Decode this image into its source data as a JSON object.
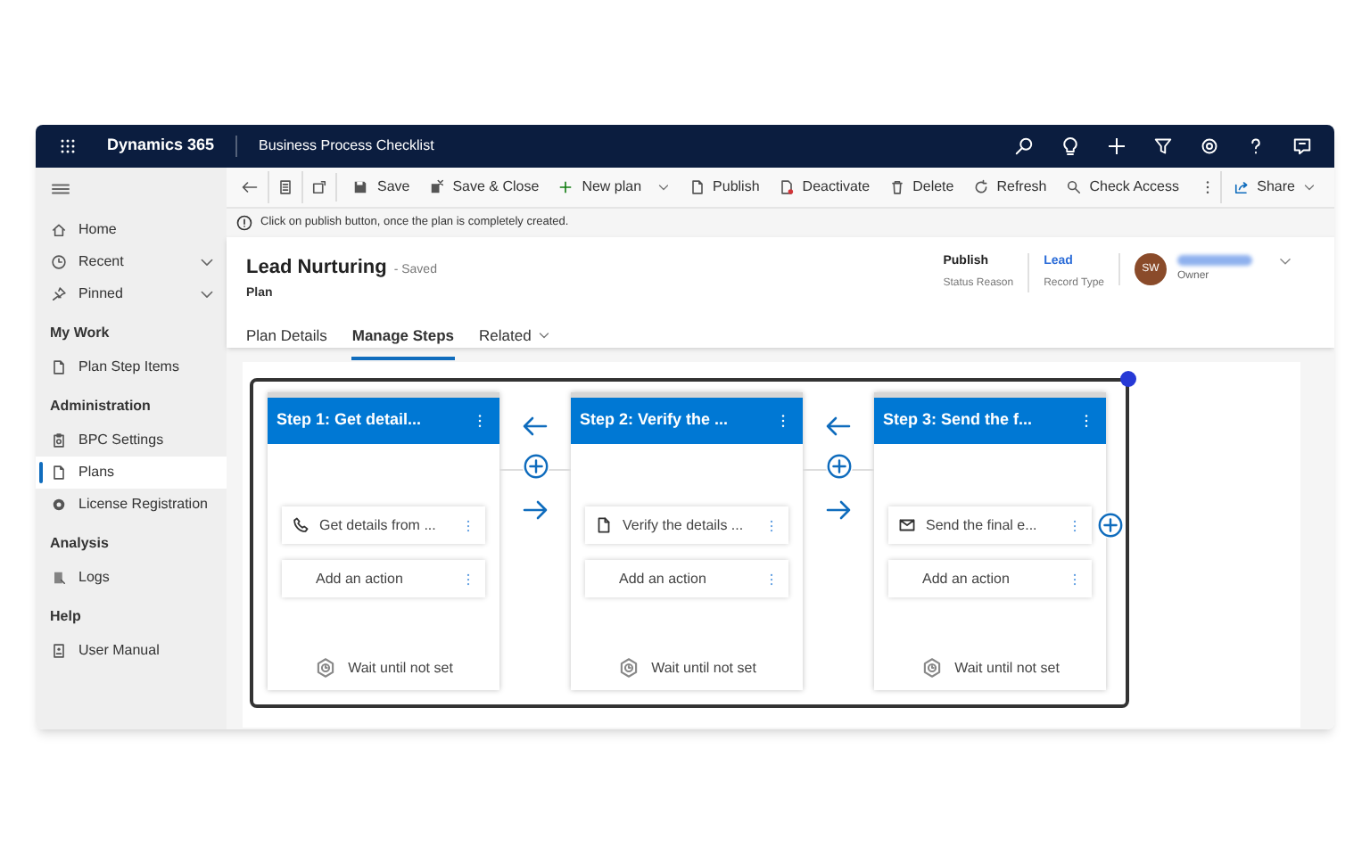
{
  "app": {
    "brand": "Dynamics 365",
    "title": "Business Process Checklist"
  },
  "sidebar": {
    "sections": [
      {
        "items": [
          {
            "label": "Home",
            "expandable": false,
            "selected": false
          },
          {
            "label": "Recent",
            "expandable": true,
            "selected": false
          },
          {
            "label": "Pinned",
            "expandable": true,
            "selected": false
          }
        ]
      },
      {
        "heading": "My Work",
        "items": [
          {
            "label": "Plan Step Items",
            "expandable": false,
            "selected": false
          }
        ]
      },
      {
        "heading": "Administration",
        "items": [
          {
            "label": "BPC Settings",
            "expandable": false,
            "selected": false
          },
          {
            "label": "Plans",
            "expandable": false,
            "selected": true
          },
          {
            "label": "License Registration",
            "expandable": false,
            "selected": false
          }
        ]
      },
      {
        "heading": "Analysis",
        "items": [
          {
            "label": "Logs",
            "expandable": false,
            "selected": false
          }
        ]
      },
      {
        "heading": "Help",
        "items": [
          {
            "label": "User Manual",
            "expandable": false,
            "selected": false
          }
        ]
      }
    ]
  },
  "commands": [
    {
      "label": "Save",
      "dropdown": false
    },
    {
      "label": "Save & Close",
      "dropdown": false
    },
    {
      "label": "New plan",
      "dropdown": true
    },
    {
      "label": "Publish",
      "dropdown": false
    },
    {
      "label": "Deactivate",
      "dropdown": false
    },
    {
      "label": "Delete",
      "dropdown": false
    },
    {
      "label": "Refresh",
      "dropdown": false
    },
    {
      "label": "Check Access",
      "dropdown": false
    }
  ],
  "share": {
    "label": "Share"
  },
  "notice": "Click on publish button, once the plan is completely created.",
  "record": {
    "title": "Lead Nurturing",
    "saved": "- Saved",
    "entity": "Plan",
    "fields": [
      {
        "value": "Publish",
        "label": "Status Reason"
      },
      {
        "value": "Lead",
        "label": "Record Type"
      }
    ],
    "owner": {
      "initials": "SW",
      "label": "Owner"
    }
  },
  "tabs": [
    {
      "label": "Plan Details",
      "selected": false,
      "dropdown": false
    },
    {
      "label": "Manage Steps",
      "selected": true,
      "dropdown": false
    },
    {
      "label": "Related",
      "selected": false,
      "dropdown": true
    }
  ],
  "steps": [
    {
      "title": "Step 1: Get detail...",
      "actions": [
        {
          "kind": "phone",
          "text": "Get details from ..."
        },
        {
          "kind": "add",
          "text": "Add an action"
        }
      ],
      "wait": "Wait until not set"
    },
    {
      "title": "Step 2: Verify the ...",
      "actions": [
        {
          "kind": "document",
          "text": "Verify the details ..."
        },
        {
          "kind": "add",
          "text": "Add an action"
        }
      ],
      "wait": "Wait until not set"
    },
    {
      "title": "Step 3: Send the f...",
      "actions": [
        {
          "kind": "mail",
          "text": "Send the final e..."
        },
        {
          "kind": "add",
          "text": "Add an action"
        }
      ],
      "wait": "Wait until not set"
    }
  ]
}
